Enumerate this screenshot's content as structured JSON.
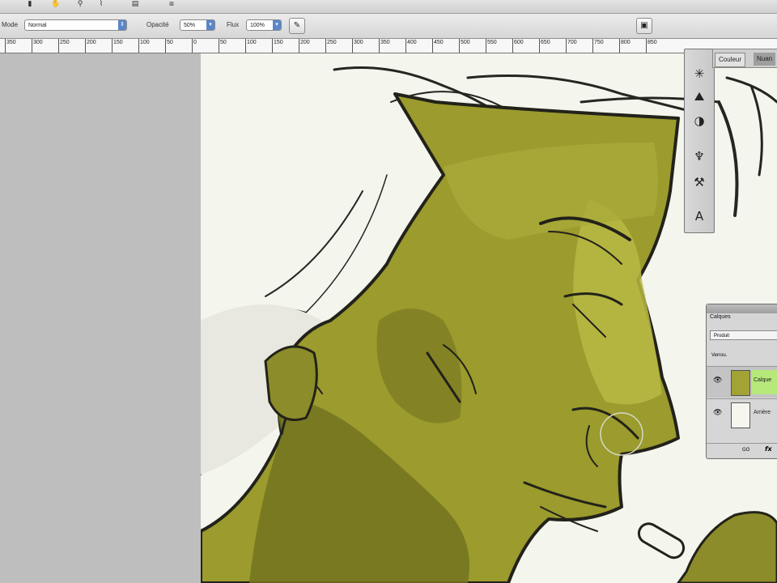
{
  "toolbar": {
    "mode_label": "Mode",
    "mode_value": "Normal",
    "opacity_label": "Opacité",
    "opacity_value": "50%",
    "flow_label": "Flux",
    "flow_value": "100%",
    "airbrush_icon": "airbrush-icon",
    "palette_icon": "palette-toggle-icon"
  },
  "ruler": {
    "ticks": [
      "350",
      "300",
      "250",
      "200",
      "150",
      "100",
      "50",
      "0",
      "50",
      "100",
      "150",
      "200",
      "250",
      "300",
      "350",
      "400",
      "450",
      "500",
      "550",
      "600",
      "650",
      "700",
      "750",
      "800",
      "850"
    ]
  },
  "panels": {
    "color_tab": "Couleur",
    "swatches_tab": "Nuan",
    "dock_icons": [
      "asterisk-icon",
      "mountain-icon",
      "half-circle-icon",
      "puppet-icon",
      "clone-icon",
      "character-icon"
    ]
  },
  "layers": {
    "tab": "Calques",
    "blend_mode": "Produit",
    "lock_label": "Verrou.",
    "items": [
      {
        "name": "Calque",
        "selected": true
      },
      {
        "name": "Arrière",
        "selected": false
      }
    ],
    "footer_link": "GO",
    "footer_fx": "fx"
  },
  "colors": {
    "skin": "#9b9b2e",
    "skin_shadow": "#737320",
    "skin_light": "#b9b944",
    "paper": "#f4f5ed",
    "line": "#1f1f1a"
  }
}
